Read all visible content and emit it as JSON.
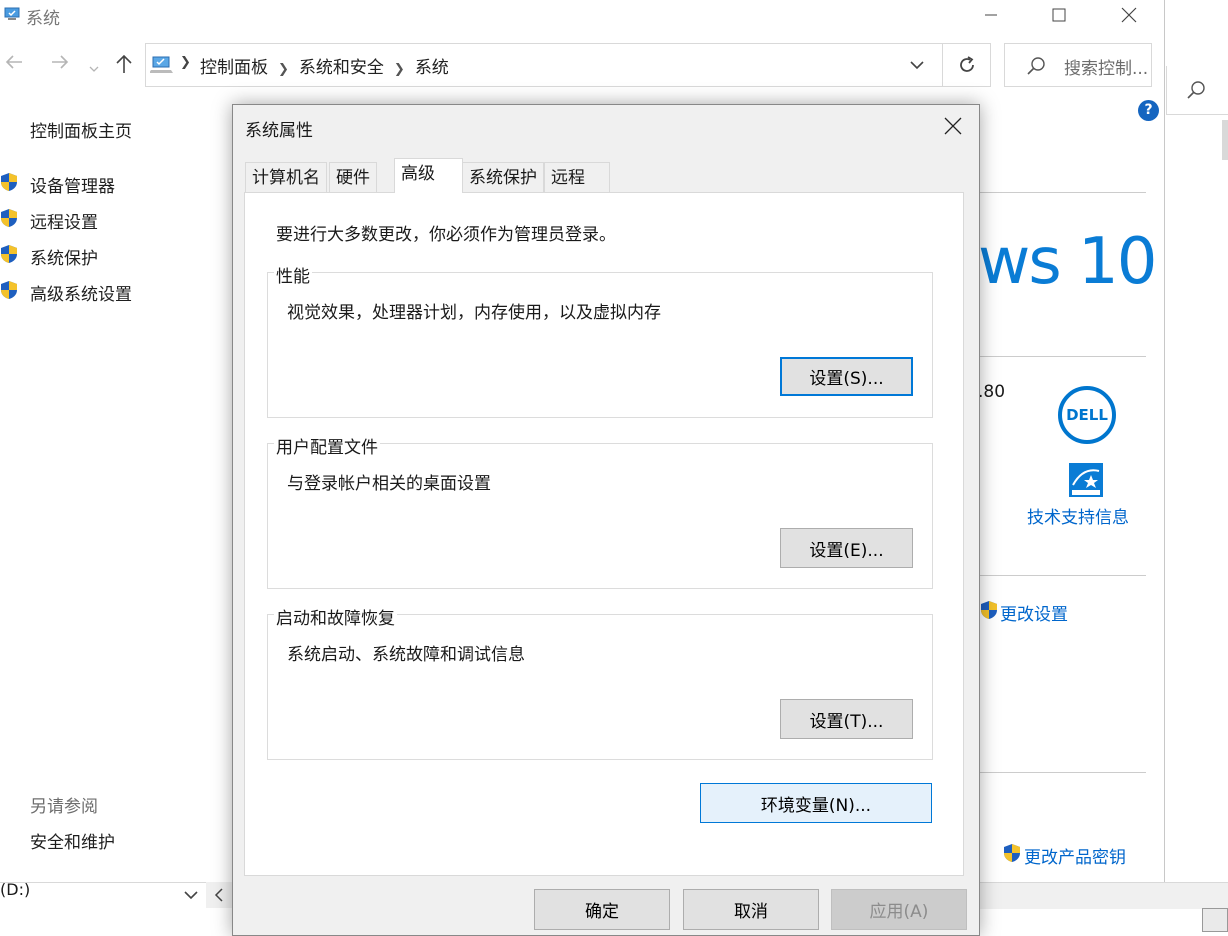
{
  "window": {
    "title": "系统",
    "minimize_icon": "minimize-icon",
    "maximize_icon": "maximize-icon",
    "close_icon": "close-icon"
  },
  "address_bar": {
    "breadcrumbs": [
      "控制面板",
      "系统和安全",
      "系统"
    ],
    "search_placeholder": "搜索控制..."
  },
  "left_nav": {
    "home": "控制面板主页",
    "links": [
      "设备管理器",
      "远程设置",
      "系统保护",
      "高级系统设置"
    ],
    "see_also_heading": "另请参阅",
    "see_also_links": [
      "安全和维护"
    ]
  },
  "background_content": {
    "windows_logo_text": "ws 10",
    "partial_value": ".80",
    "dell_logo": "DELL",
    "support_link": "技术支持信息",
    "change_settings": "更改设置",
    "change_product_key": "更改产品密钥",
    "help_icon": "?",
    "drive_label": "(D:)"
  },
  "dialog": {
    "title": "系统属性",
    "tabs": [
      "计算机名",
      "硬件",
      "高级",
      "系统保护",
      "远程"
    ],
    "active_tab": "高级",
    "admin_note": "要进行大多数更改，你必须作为管理员登录。",
    "groups": [
      {
        "legend": "性能",
        "description": "视觉效果，处理器计划，内存使用，以及虚拟内存",
        "button": "设置(S)..."
      },
      {
        "legend": "用户配置文件",
        "description": "与登录帐户相关的桌面设置",
        "button": "设置(E)..."
      },
      {
        "legend": "启动和故障恢复",
        "description": "系统启动、系统故障和调试信息",
        "button": "设置(T)..."
      }
    ],
    "env_button": "环境变量(N)...",
    "ok_button": "确定",
    "cancel_button": "取消",
    "apply_button": "应用(A)"
  },
  "colors": {
    "accent": "#0078d7",
    "link": "#0066cc",
    "win10_blue": "#0a7cd5",
    "dell_blue": "#0076ce"
  }
}
